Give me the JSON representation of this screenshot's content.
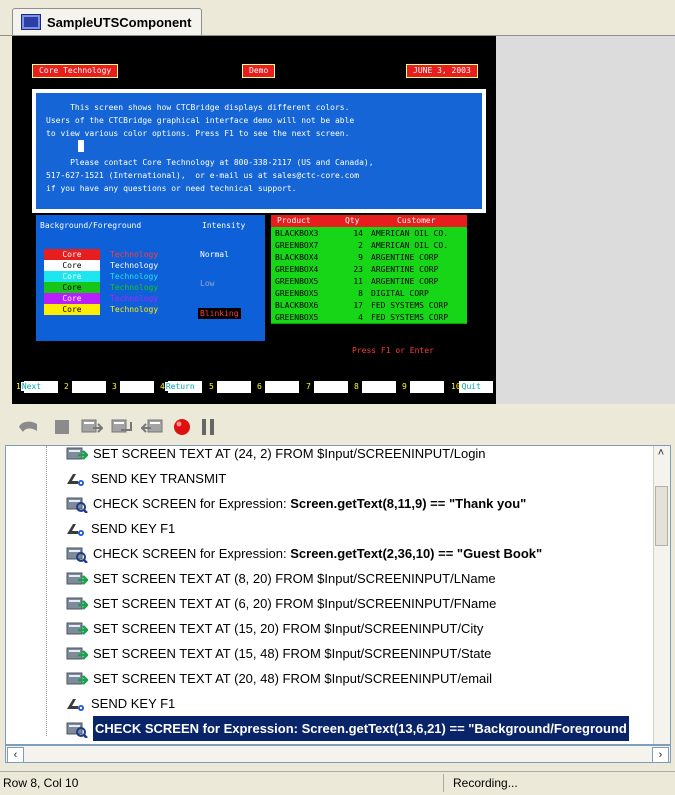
{
  "tab": {
    "title": "SampleUTSComponent"
  },
  "screen": {
    "header": {
      "left": "Core Technology",
      "center": "Demo",
      "date": "JUNE 3, 2003"
    },
    "message_lines": [
      "     This screen shows how CTCBridge displays different colors.",
      "Users of the CTCBridge graphical interface demo will not be able",
      "to view various color options. Press F1 to see the next screen.",
      "",
      "     Please contact Core Technology at 800-338-2117 (US and Canada),",
      "517-627-1521 (International),  or e-mail us at sales@ctc-core.com",
      "if you have any questions or need technical support."
    ],
    "legend": {
      "h1": "Background/Foreground",
      "h2": "Intensity",
      "core": "Core",
      "tech": "Technology",
      "rows": [
        {
          "bg": "#e81e1e",
          "fg": "#ffffff",
          "tech_color": "#ff3b3b"
        },
        {
          "bg": "#ffffff",
          "fg": "#000000",
          "tech_color": "#ffffff"
        },
        {
          "bg": "#1ee6ee",
          "fg": "#ffffff",
          "tech_color": "#1ee6ee"
        },
        {
          "bg": "#17c617",
          "fg": "#000000",
          "tech_color": "#17c617"
        },
        {
          "bg": "#b81eff",
          "fg": "#ffffff",
          "tech_color": "#b81eff"
        },
        {
          "bg": "#ffee00",
          "fg": "#000000",
          "tech_color": "#ffee00"
        }
      ],
      "intensity": {
        "normal": "Normal",
        "low": "Low",
        "blinking": "Blinking"
      }
    },
    "product_table": {
      "headers": [
        "Product",
        "Qty",
        "Customer"
      ],
      "rows": [
        [
          "BLACKBOX3",
          "14",
          "AMERICAN OIL CO."
        ],
        [
          "GREENBOX7",
          "2",
          "AMERICAN OIL CO."
        ],
        [
          "BLACKBOX4",
          "9",
          "ARGENTINE CORP"
        ],
        [
          "GREENBOX4",
          "23",
          "ARGENTINE CORP"
        ],
        [
          "GREENBOX5",
          "11",
          "ARGENTINE CORP"
        ],
        [
          "GREENBOX5",
          "8",
          "DIGITAL CORP"
        ],
        [
          "BLACKBOX6",
          "17",
          "FED SYSTEMS CORP"
        ],
        [
          "GREENBOX5",
          "4",
          "FED SYSTEMS CORP"
        ]
      ]
    },
    "hint": "Press F1 or Enter",
    "fkeys": [
      {
        "num": "1",
        "label": "Next"
      },
      {
        "num": "2",
        "label": ""
      },
      {
        "num": "3",
        "label": ""
      },
      {
        "num": "4",
        "label": "Return"
      },
      {
        "num": "5",
        "label": ""
      },
      {
        "num": "6",
        "label": ""
      },
      {
        "num": "7",
        "label": ""
      },
      {
        "num": "8",
        "label": ""
      },
      {
        "num": "9",
        "label": ""
      },
      {
        "num": "10",
        "label": "Quit"
      }
    ]
  },
  "toolbar": {
    "buttons": [
      "undo-icon",
      "stop-icon",
      "step-forward-icon",
      "step-over-icon",
      "step-back-icon",
      "record-icon",
      "pause-icon"
    ]
  },
  "script_steps": [
    {
      "type": "set",
      "text": "SET SCREEN TEXT AT (24, 2) FROM $Input/SCREENINPUT/Login"
    },
    {
      "type": "key",
      "text": "SEND KEY TRANSMIT"
    },
    {
      "type": "check",
      "text": "CHECK SCREEN for Expression: ",
      "bold": "Screen.getText(8,11,9) == \"Thank you\""
    },
    {
      "type": "key",
      "text": "SEND KEY F1"
    },
    {
      "type": "check",
      "text": "CHECK SCREEN for Expression: ",
      "bold": "Screen.getText(2,36,10) == \"Guest Book\""
    },
    {
      "type": "set",
      "text": "SET SCREEN TEXT AT (8, 20) FROM $Input/SCREENINPUT/LName"
    },
    {
      "type": "set",
      "text": "SET SCREEN TEXT AT (6, 20) FROM $Input/SCREENINPUT/FName"
    },
    {
      "type": "set",
      "text": "SET SCREEN TEXT AT (15, 20) FROM $Input/SCREENINPUT/City"
    },
    {
      "type": "set",
      "text": "SET SCREEN TEXT AT (15, 48) FROM $Input/SCREENINPUT/State"
    },
    {
      "type": "set",
      "text": "SET SCREEN TEXT AT (20, 48) FROM $Input/SCREENINPUT/email"
    },
    {
      "type": "key",
      "text": "SEND KEY F1"
    },
    {
      "type": "check_selected",
      "text": "CHECK SCREEN for Expression: Screen.getText(13,6,21) == \"Background/Foreground"
    }
  ],
  "status": {
    "position": "Row 8, Col 10",
    "mode": "Recording..."
  }
}
